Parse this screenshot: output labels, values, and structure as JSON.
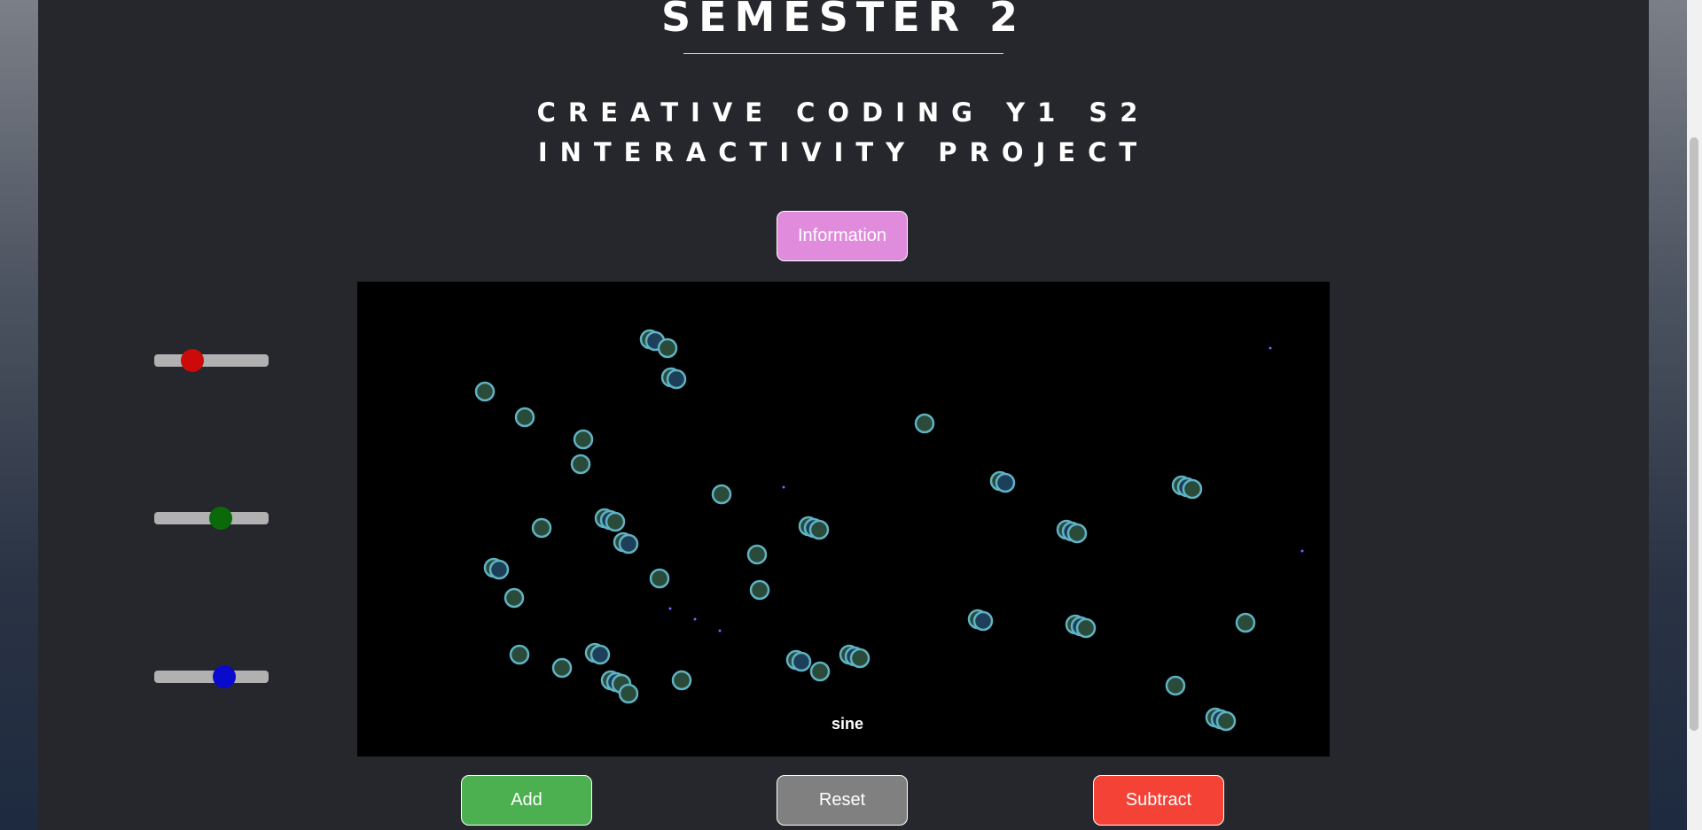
{
  "header": {
    "title": "SEMESTER 2",
    "subtitle_line1": "CREATIVE CODING Y1 S2",
    "subtitle_line2": "INTERACTIVITY PROJECT"
  },
  "info_button": {
    "label": "Information",
    "color": "#e08bdb"
  },
  "sliders": [
    {
      "name": "red",
      "color": "#cc0a0a",
      "value": 0.33
    },
    {
      "name": "green",
      "color": "#0a6a0a",
      "value": 0.58
    },
    {
      "name": "blue",
      "color": "#0a0acc",
      "value": 0.61
    }
  ],
  "canvas": {
    "mode_label": "sine"
  },
  "controls": {
    "add_label": "Add",
    "reset_label": "Reset",
    "subtract_label": "Subtract",
    "add_color": "#4caf50",
    "reset_color": "#808080",
    "subtract_color": "#f44336"
  }
}
